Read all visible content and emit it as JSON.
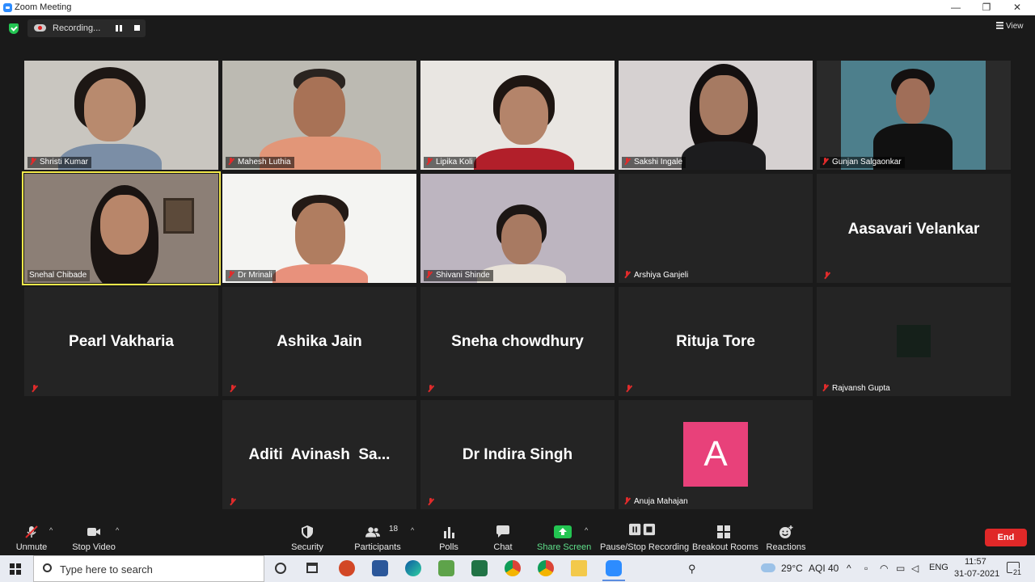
{
  "window": {
    "title": "Zoom Meeting",
    "minimize_glyph": "—",
    "maximize_glyph": "❐",
    "close_glyph": "✕"
  },
  "recording": {
    "label": "Recording..."
  },
  "view": {
    "label": "View"
  },
  "participants": [
    {
      "name": "Shristi Kumar",
      "video": true
    },
    {
      "name": "Mahesh Luthia",
      "video": true
    },
    {
      "name": "Lipika Koli",
      "video": true
    },
    {
      "name": "Sakshi Ingale",
      "video": true
    },
    {
      "name": "Gunjan Salgaonkar",
      "video": true
    },
    {
      "name": "Snehal Chibade",
      "video": true,
      "active_speaker": true
    },
    {
      "name": "Dr Mrinali",
      "video": true
    },
    {
      "name": "Shivani Shinde",
      "video": true
    },
    {
      "name": "Arshiya Ganjeli",
      "video": false
    },
    {
      "name": "Aasavari Velankar",
      "video": false,
      "display": "Aasavari Velankar"
    },
    {
      "name": "Pearl Vakharia",
      "video": false,
      "display": "Pearl Vakharia"
    },
    {
      "name": "Ashika Jain",
      "video": false,
      "display": "Ashika Jain"
    },
    {
      "name": "Sneha chowdhury",
      "video": false,
      "display": "Sneha chowdhury"
    },
    {
      "name": "Rituja Tore",
      "video": false,
      "display": "Rituja Tore"
    },
    {
      "name": "Rajvansh Gupta",
      "video": false
    },
    {
      "name": "Aditi Avinash Sa...",
      "video": false,
      "display": "Aditi  Avinash  Sa..."
    },
    {
      "name": "Dr Indira Singh",
      "video": false,
      "display": "Dr Indira Singh"
    },
    {
      "name": "Anuja Mahajan",
      "video": false,
      "avatar_letter": "A"
    }
  ],
  "toolbar": {
    "unmute": "Unmute",
    "stop_video": "Stop Video",
    "security": "Security",
    "participants": "Participants",
    "participant_count": "18",
    "polls": "Polls",
    "chat": "Chat",
    "share_screen": "Share Screen",
    "pause_stop_recording": "Pause/Stop Recording",
    "breakout_rooms": "Breakout Rooms",
    "reactions": "Reactions",
    "end": "End"
  },
  "taskbar": {
    "search_placeholder": "Type here to search",
    "weather": "29°C",
    "aqi": "AQI 40",
    "language": "ENG",
    "time": "11:57",
    "date": "31-07-2021",
    "notifications": "21"
  },
  "colors": {
    "accent": "#2d8cff",
    "share_green": "#23c552",
    "end_red": "#e02828",
    "speaker_outline": "#f2e84a",
    "avatar_pink": "#e8417a"
  }
}
